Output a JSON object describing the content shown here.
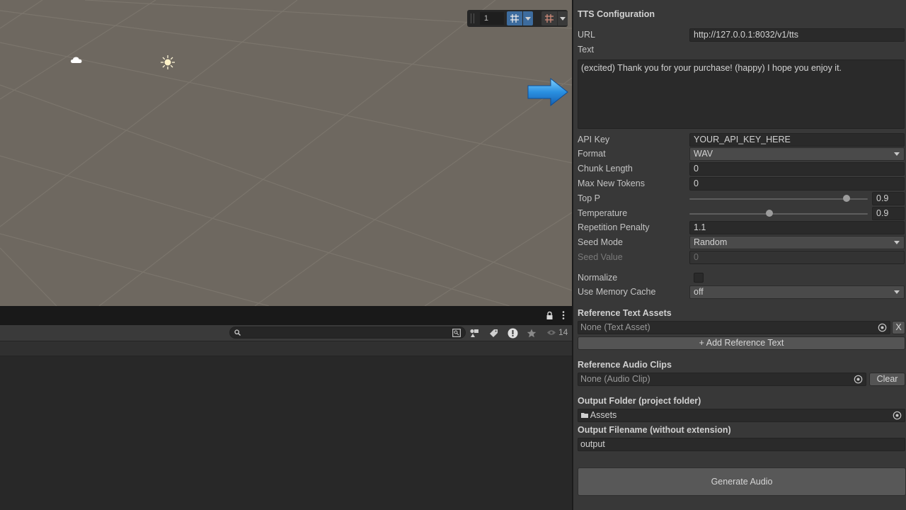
{
  "scene": {
    "toolbar": {
      "number_value": "1"
    }
  },
  "hierarchy": {
    "search": {
      "placeholder": ""
    },
    "hidden_count": "14"
  },
  "inspector": {
    "title": "TTS Configuration",
    "fields": {
      "url": {
        "label": "URL",
        "value": "http://127.0.0.1:8032/v1/tts"
      },
      "text": {
        "label": "Text",
        "value": "(excited) Thank you for your purchase! (happy) I hope you enjoy it."
      },
      "api_key": {
        "label": "API Key",
        "value": "YOUR_API_KEY_HERE"
      },
      "format": {
        "label": "Format",
        "value": "WAV"
      },
      "chunk_length": {
        "label": "Chunk Length",
        "value": "0"
      },
      "max_new_tokens": {
        "label": "Max New Tokens",
        "value": "0"
      },
      "top_p": {
        "label": "Top P",
        "value": "0.9"
      },
      "temperature": {
        "label": "Temperature",
        "value": "0.9"
      },
      "repetition_penalty": {
        "label": "Repetition Penalty",
        "value": "1.1"
      },
      "seed_mode": {
        "label": "Seed Mode",
        "value": "Random"
      },
      "seed_value": {
        "label": "Seed Value",
        "value": "0"
      },
      "normalize": {
        "label": "Normalize",
        "checked": false
      },
      "use_memory_cache": {
        "label": "Use Memory Cache",
        "value": "off"
      }
    },
    "reference_text": {
      "header": "Reference Text Assets",
      "slot_value": "None (Text Asset)",
      "remove_label": "X",
      "add_label": "+ Add Reference Text"
    },
    "reference_audio": {
      "header": "Reference Audio Clips",
      "slot_value": "None (Audio Clip)",
      "clear_label": "Clear"
    },
    "output_folder": {
      "header": "Output Folder (project folder)",
      "value": "Assets"
    },
    "output_filename": {
      "header": "Output Filename (without extension)",
      "value": "output"
    },
    "generate_label": "Generate Audio"
  }
}
